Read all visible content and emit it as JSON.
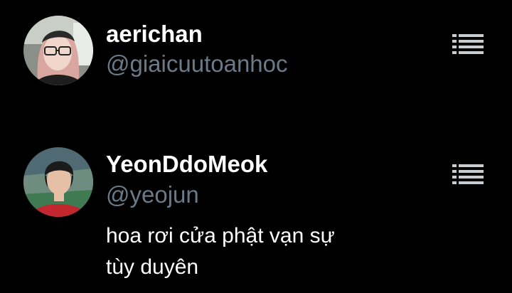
{
  "accounts": [
    {
      "display_name": "aerichan",
      "handle": "@giaicuutoanhoc",
      "avatar_icon": "profile-photo-girl-glasses",
      "menu_icon": "list-menu-icon"
    },
    {
      "display_name": "YeonDdoMeok",
      "handle": "@yeojun",
      "bio_lines": [
        "hoa rơi cửa phật vạn sự",
        "tùy duyên"
      ],
      "avatar_icon": "profile-photo-boy-red-shirt",
      "menu_icon": "list-menu-icon"
    }
  ],
  "colors": {
    "background": "#000000",
    "primary_text": "#ffffff",
    "secondary_text": "#6b7a88",
    "icon": "#c8cdd2"
  }
}
